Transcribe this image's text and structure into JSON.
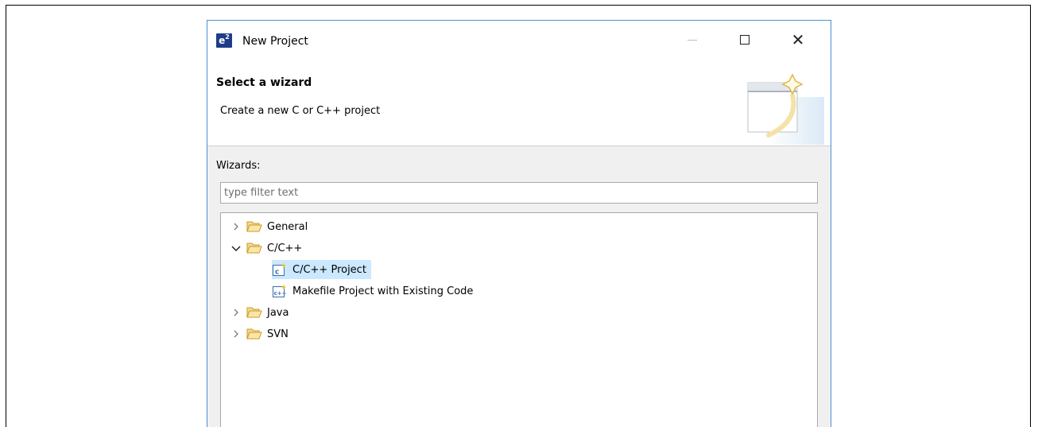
{
  "window": {
    "title": "New Project",
    "app_icon_text": "e",
    "app_icon_sup": "2",
    "icons": {
      "app": "e2-studio-icon",
      "minimize": "minimize-icon",
      "maximize": "maximize-icon",
      "close": "close-icon"
    }
  },
  "banner": {
    "title": "Select a wizard",
    "description": "Create a new C or C++ project",
    "art_icon": "new-wizard-banner-icon"
  },
  "wizards": {
    "label": "Wizards:",
    "filter_placeholder": "type filter text",
    "filter_value": "",
    "tree": {
      "general": {
        "label": "General",
        "expanded": false,
        "icon": "folder-icon"
      },
      "cpp": {
        "label": "C/C++",
        "expanded": true,
        "icon": "folder-icon",
        "children": [
          {
            "label": "C/C++ Project",
            "icon": "c-project-icon",
            "selected": true
          },
          {
            "label": "Makefile Project with Existing Code",
            "icon": "makefile-project-icon",
            "selected": false
          }
        ]
      },
      "java": {
        "label": "Java",
        "expanded": false,
        "icon": "folder-icon"
      },
      "svn": {
        "label": "SVN",
        "expanded": false,
        "icon": "folder-icon"
      }
    }
  },
  "colors": {
    "window_border": "#4a8fd6",
    "selection": "#cce8ff",
    "folder_fill": "#f7d98b",
    "folder_stroke": "#c89a2a"
  }
}
